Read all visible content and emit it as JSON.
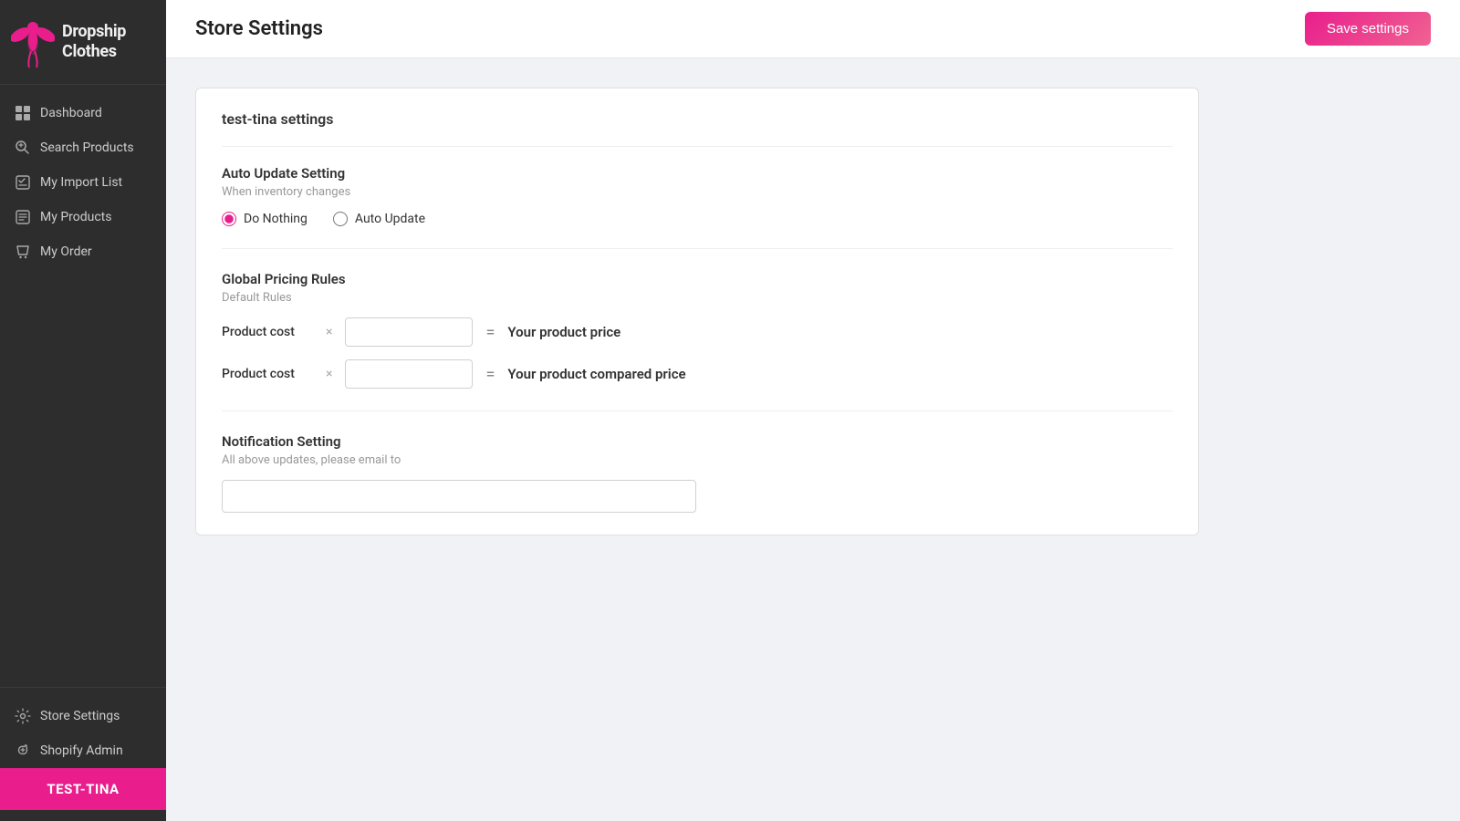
{
  "app": {
    "name": "Dropship Clothes"
  },
  "sidebar": {
    "nav_items": [
      {
        "id": "dashboard",
        "label": "Dashboard",
        "icon": "dashboard-icon"
      },
      {
        "id": "search-products",
        "label": "Search Products",
        "icon": "search-products-icon"
      },
      {
        "id": "my-import-list",
        "label": "My Import List",
        "icon": "import-list-icon"
      },
      {
        "id": "my-products",
        "label": "My Products",
        "icon": "my-products-icon"
      },
      {
        "id": "my-order",
        "label": "My Order",
        "icon": "my-order-icon"
      }
    ],
    "bottom_items": [
      {
        "id": "store-settings",
        "label": "Store Settings",
        "icon": "gear-icon"
      },
      {
        "id": "shopify-admin",
        "label": "Shopify Admin",
        "icon": "shopify-icon"
      }
    ],
    "user_label": "TEST-TINA"
  },
  "header": {
    "title": "Store Settings",
    "save_button": "Save settings"
  },
  "main": {
    "card_title": "test-tina settings",
    "auto_update": {
      "label": "Auto Update Setting",
      "sub": "When inventory changes",
      "options": [
        {
          "id": "do-nothing",
          "label": "Do Nothing",
          "checked": true
        },
        {
          "id": "auto-update",
          "label": "Auto Update",
          "checked": false
        }
      ]
    },
    "global_pricing": {
      "label": "Global Pricing Rules",
      "sub": "Default Rules",
      "rows": [
        {
          "cost_label": "Product cost",
          "times": "×",
          "equals": "=",
          "result": "Your product price"
        },
        {
          "cost_label": "Product cost",
          "times": "×",
          "equals": "=",
          "result": "Your product compared price"
        }
      ]
    },
    "notification": {
      "label": "Notification Setting",
      "sub": "All above updates, please email to",
      "placeholder": ""
    }
  }
}
